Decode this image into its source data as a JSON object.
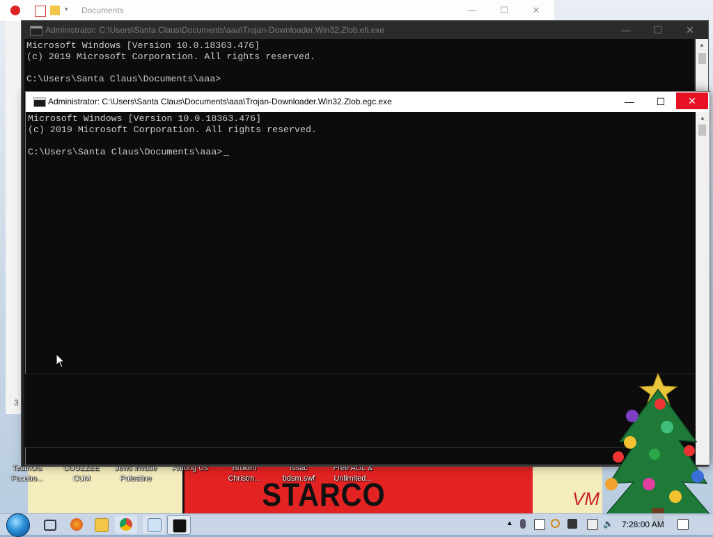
{
  "explorer": {
    "title": "Documents",
    "status_text": "3"
  },
  "cmd_back": {
    "title": "Administrator: C:\\Users\\Santa Claus\\Documents\\aaa\\Trojan-Downloader.Win32.Zlob.efi.exe",
    "console_lines": "Microsoft Windows [Version 10.0.18363.476]\n(c) 2019 Microsoft Corporation. All rights reserved.\n\nC:\\Users\\Santa Claus\\Documents\\aaa>"
  },
  "cmd_front": {
    "title": "Administrator: C:\\Users\\Santa Claus\\Documents\\aaa\\Trojan-Downloader.Win32.Zlob.egc.exe",
    "console_lines": "Microsoft Windows [Version 10.0.18363.476]\n(c) 2019 Microsoft Corporation. All rights reserved.\n\nC:\\Users\\Santa Claus\\Documents\\aaa>",
    "cursor": "_"
  },
  "caption_buttons": {
    "minimize": "—",
    "maximize": "☐",
    "close": "✕"
  },
  "desktop_icons": [
    {
      "line1": "TeamOS",
      "line2": "Facebo..."
    },
    {
      "line1": "CUUZZEE",
      "line2": "CUM"
    },
    {
      "line1": "Jews invade",
      "line2": "Palestine"
    },
    {
      "line1": "Among Us",
      "line2": ""
    },
    {
      "line1": "Broken",
      "line2": "Christm..."
    },
    {
      "line1": "Issac",
      "line2": "bdsm.swf"
    },
    {
      "line1": "Free AOL &",
      "line2": "Unlimited..."
    }
  ],
  "wallpaper": {
    "banner_text": "STARCO",
    "watermark": "VM"
  },
  "taskbar": {
    "clock": "7:28:00 AM",
    "apps": [
      "task-view",
      "firefox",
      "file-explorer",
      "chrome",
      "control-panel",
      "command-prompt"
    ]
  },
  "colors": {
    "console_bg": "#0c0c0c",
    "console_fg": "#cccccc",
    "close_red": "#e81123"
  }
}
